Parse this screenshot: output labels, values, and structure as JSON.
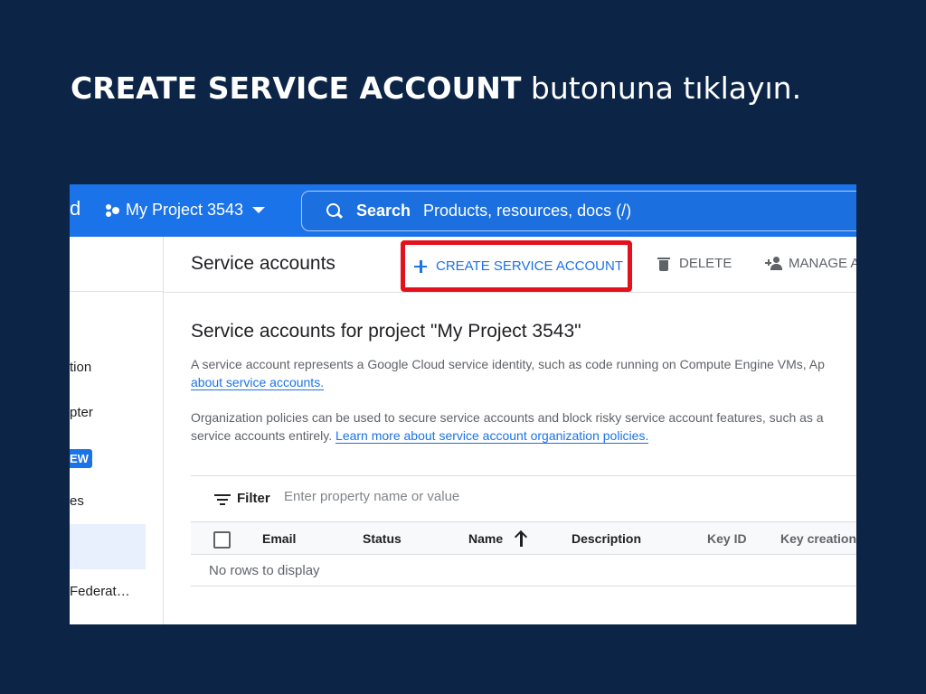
{
  "instruction": {
    "bold": "CREATE SERVICE ACCOUNT",
    "rest": " butonuna tıklayın."
  },
  "topbar": {
    "edge_text": "d",
    "project_name": "My Project 3543",
    "search_label": "Search",
    "search_placeholder": "Products, resources, docs (/)"
  },
  "leftnav": {
    "items": [
      "tion",
      "pter",
      "es",
      "Federat…"
    ],
    "new_badge": "EW"
  },
  "toolbar": {
    "page_title": "Service accounts",
    "create_label": "CREATE SERVICE ACCOUNT",
    "delete_label": "DELETE",
    "manage_label": "MANAGE A"
  },
  "content": {
    "section_title": "Service accounts for project \"My Project 3543\"",
    "desc1_line1": "A service account represents a Google Cloud service identity, such as code running on Compute Engine VMs, Ap",
    "desc1_link": "about service accounts.",
    "desc2_line1": "Organization policies can be used to secure service accounts and block risky service account features, such as a",
    "desc2_line2_prefix": "service accounts entirely. ",
    "desc2_link": "Learn more about service account organization policies."
  },
  "table": {
    "filter_label": "Filter",
    "filter_placeholder": "Enter property name or value",
    "columns": [
      "Email",
      "Status",
      "Name",
      "Description",
      "Key ID",
      "Key creation"
    ],
    "empty_text": "No rows to display"
  },
  "colors": {
    "background": "#0c2547",
    "topbar": "#1a73e8",
    "highlight": "#e3111b",
    "link": "#1a73e8"
  }
}
